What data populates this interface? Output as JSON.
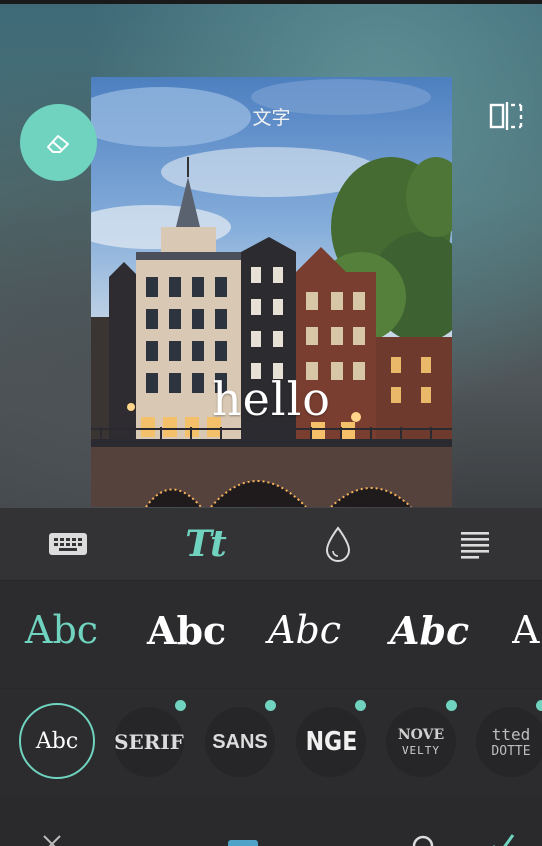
{
  "overlay": {
    "title": "文字",
    "hello": "hello"
  },
  "tabs": [
    {
      "name": "keyboard-icon"
    },
    {
      "name": "font-style-icon",
      "label": "Tt",
      "active": true
    },
    {
      "name": "color-drop-icon"
    },
    {
      "name": "align-icon"
    }
  ],
  "styles": [
    {
      "label": "Abc",
      "variant": "regular",
      "active": true
    },
    {
      "label": "Abc",
      "variant": "bold"
    },
    {
      "label": "Abc",
      "variant": "italic"
    },
    {
      "label": "Abc",
      "variant": "bold-italic"
    },
    {
      "label": "A",
      "variant": "partial"
    }
  ],
  "fonts": [
    {
      "label": "Abc",
      "selected": true
    },
    {
      "label": "SERIF"
    },
    {
      "label": "SANS"
    },
    {
      "label": "NGE"
    },
    {
      "label_top": "NOVE",
      "label_bottom": "VELTY"
    },
    {
      "label_top": "tted",
      "label_bottom": "DOTTE"
    }
  ],
  "colors": {
    "accent": "#6fd3bf",
    "panel": "#2c2c2e",
    "toolbar": "#333335"
  }
}
